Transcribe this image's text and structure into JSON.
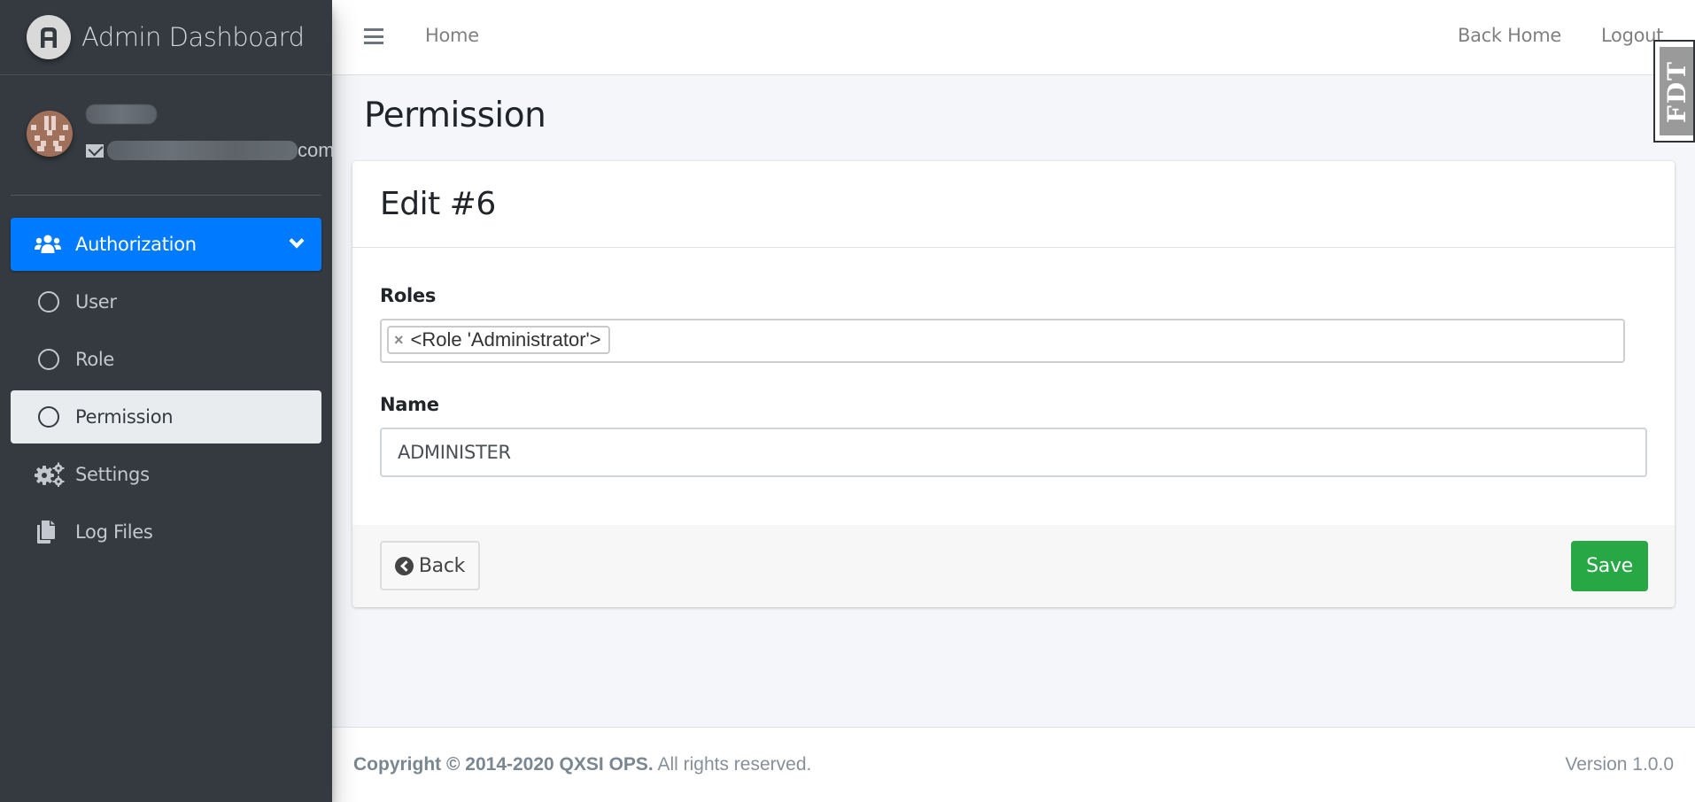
{
  "brand": {
    "title": "Admin Dashboard",
    "logo_icon": "a-letter-logo"
  },
  "user": {
    "name": "[redacted]",
    "email_suffix": "com",
    "email_icon": "envelope-icon"
  },
  "sidebar": {
    "items": [
      {
        "label": "Authorization",
        "icon": "users-icon",
        "state": "expanded-active"
      },
      {
        "label": "User",
        "icon": "circle-icon",
        "state": ""
      },
      {
        "label": "Role",
        "icon": "circle-icon",
        "state": ""
      },
      {
        "label": "Permission",
        "icon": "circle-icon",
        "state": "current"
      },
      {
        "label": "Settings",
        "icon": "cogs-icon",
        "state": ""
      },
      {
        "label": "Log Files",
        "icon": "copy-files-icon",
        "state": ""
      }
    ]
  },
  "header": {
    "menu_icon": "hamburger-icon",
    "home_link": "Home",
    "back_home_link": "Back Home",
    "logout_link": "Logout"
  },
  "widget": {
    "label": "FDT"
  },
  "page": {
    "title": "Permission"
  },
  "card": {
    "title": "Edit #6",
    "roles_label": "Roles",
    "roles_selected": [
      "<Role 'Administrator'>"
    ],
    "remove_symbol": "×",
    "name_label": "Name",
    "name_value": "ADMINISTER",
    "back_label": "Back",
    "save_label": "Save"
  },
  "footer": {
    "copyright_bold": "Copyright © 2014-2020 QXSI OPS.",
    "copyright_rest": " All rights reserved.",
    "version": "Version 1.0.0"
  },
  "colors": {
    "sidebar_bg": "#343a40",
    "active_item": "#007bff",
    "current_item": "#e9ecef",
    "save_button": "#28a745",
    "content_bg": "#f4f6f9"
  }
}
